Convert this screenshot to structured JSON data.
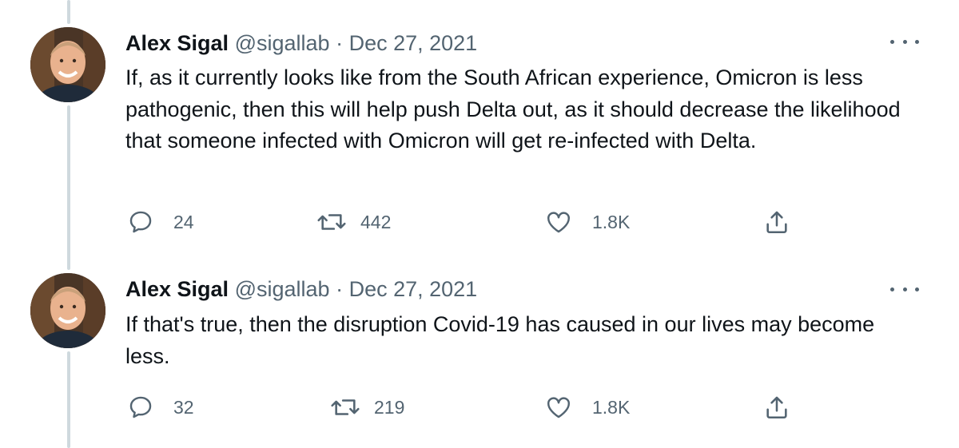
{
  "tweets": [
    {
      "author_name": "Alex Sigal",
      "handle": "@sigallab",
      "separator": "·",
      "date": "Dec 27, 2021",
      "text": "If, as it currently looks like from the South African experience, Omicron is less pathogenic, then this will help push Delta out, as it should decrease the likelihood that someone infected with Omicron will get re-infected with Delta.",
      "replies": "24",
      "retweets": "442",
      "likes": "1.8K",
      "icons": [
        "reply-icon",
        "retweet-icon",
        "like-icon",
        "share-icon",
        "more-icon"
      ]
    },
    {
      "author_name": "Alex Sigal",
      "handle": "@sigallab",
      "separator": "·",
      "date": "Dec 27, 2021",
      "text": "If that's true, then the disruption Covid-19 has caused in our lives may become less.",
      "replies": "32",
      "retweets": "219",
      "likes": "1.8K",
      "icons": [
        "reply-icon",
        "retweet-icon",
        "like-icon",
        "share-icon",
        "more-icon"
      ]
    }
  ],
  "colors": {
    "text": "#0f1419",
    "secondary": "#536471",
    "thread_line": "#cfd9de"
  }
}
